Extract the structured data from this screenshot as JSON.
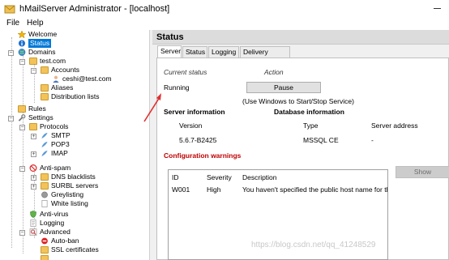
{
  "window": {
    "title": "hMailServer Administrator - [localhost]"
  },
  "menu": {
    "file": "File",
    "help": "Help"
  },
  "tree": {
    "welcome": "Welcome",
    "status": "Status",
    "domains": "Domains",
    "test_com": "test.com",
    "accounts": "Accounts",
    "account_1": "ceshi@test.com",
    "aliases": "Aliases",
    "distribution_lists": "Distribution lists",
    "rules": "Rules",
    "settings": "Settings",
    "protocols": "Protocols",
    "smtp": "SMTP",
    "pop3": "POP3",
    "imap": "IMAP",
    "anti_spam": "Anti-spam",
    "dns_blacklists": "DNS blacklists",
    "surbl_servers": "SURBL servers",
    "greylisting": "Greylisting",
    "white_listing": "White listing",
    "anti_virus": "Anti-virus",
    "logging": "Logging",
    "advanced": "Advanced",
    "auto_ban": "Auto-ban",
    "ssl_certificates": "SSL certificates"
  },
  "panel": {
    "title": "Status",
    "tabs": [
      "Server",
      "Status",
      "Logging",
      "Delivery queue"
    ],
    "current_status_label": "Current status",
    "action_label": "Action",
    "status_value": "Running",
    "pause_button": "Pause",
    "hint": "(Use Windows to Start/Stop Service)",
    "server_info_heading": "Server information",
    "database_info_heading": "Database information",
    "version_label": "Version",
    "version_value": "5.6.7-B2425",
    "type_label": "Type",
    "type_value": "MSSQL CE",
    "server_address_label": "Server address",
    "server_address_value": "-",
    "config_warnings_heading": "Configuration warnings",
    "warnings_columns": [
      "ID",
      "Severity",
      "Description"
    ],
    "warnings_rows": [
      {
        "id": "W001",
        "severity": "High",
        "description": "You haven't specified the public host name for this c"
      }
    ],
    "show_button": "Show"
  },
  "watermark": "https://blog.csdn.net/qq_41248529",
  "colors": {
    "selection": "#0078d7",
    "warning_heading": "#c00000",
    "annotation_arrow": "#e03030"
  }
}
